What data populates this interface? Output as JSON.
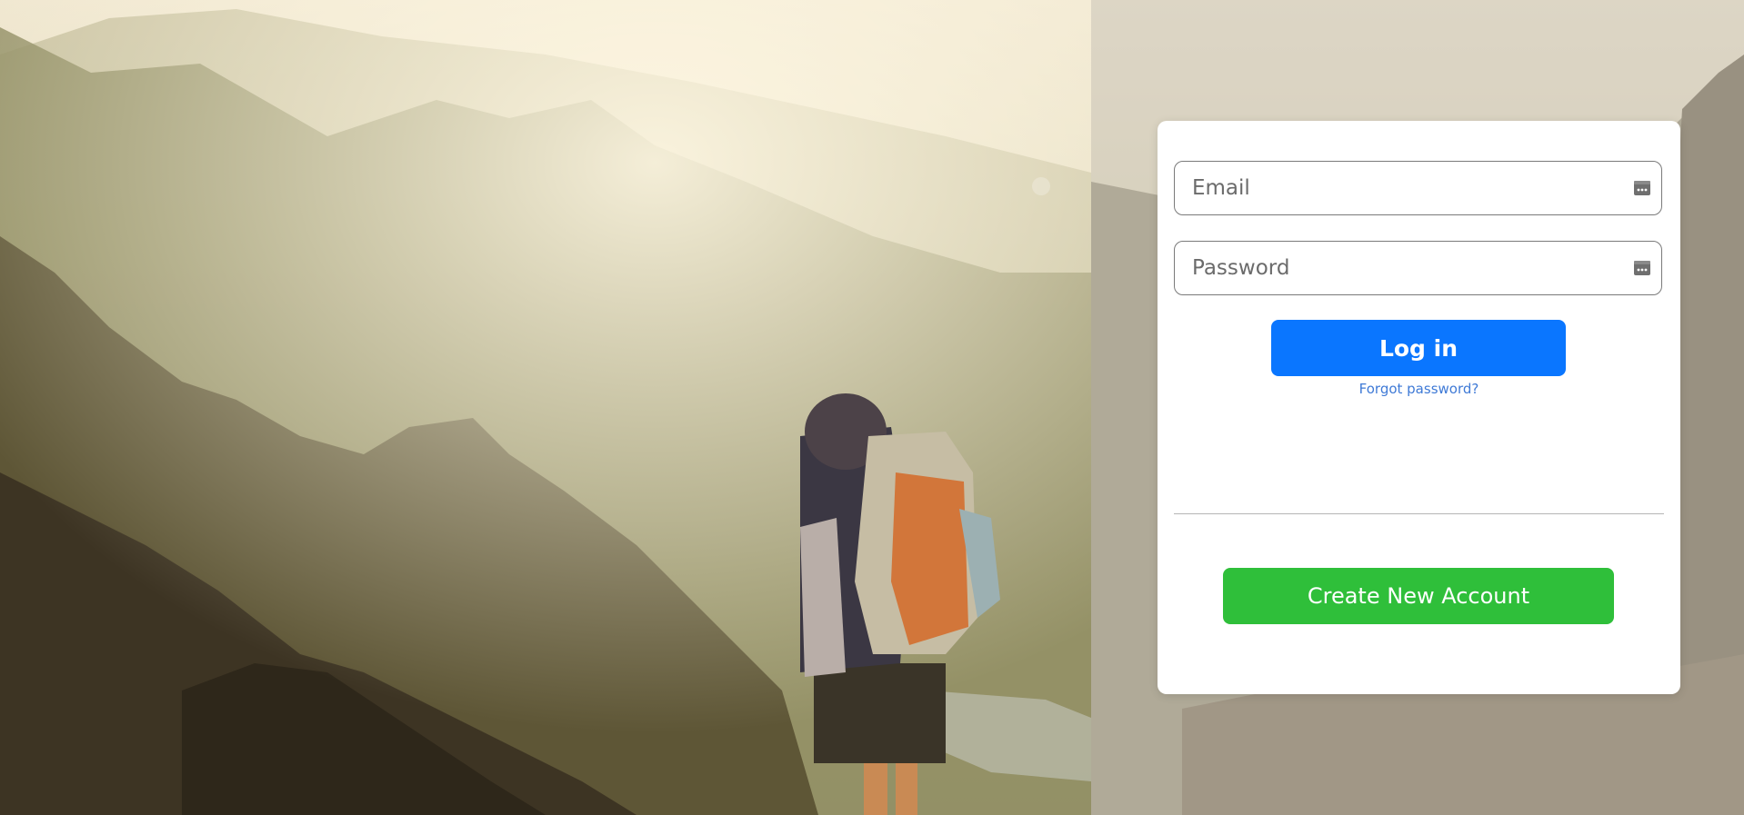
{
  "background": {
    "description_icon": "mountain-hiker-photo"
  },
  "login_form": {
    "email_placeholder": "Email",
    "password_placeholder": "Password",
    "login_label": "Log in",
    "forgot_label": "Forgot password?",
    "create_label": "Create New Account",
    "field_icon": "password-manager-key-icon"
  },
  "colors": {
    "login_button": "#0a76ff",
    "create_button": "#2fbf3a",
    "forgot_link": "#3f7ad6"
  }
}
